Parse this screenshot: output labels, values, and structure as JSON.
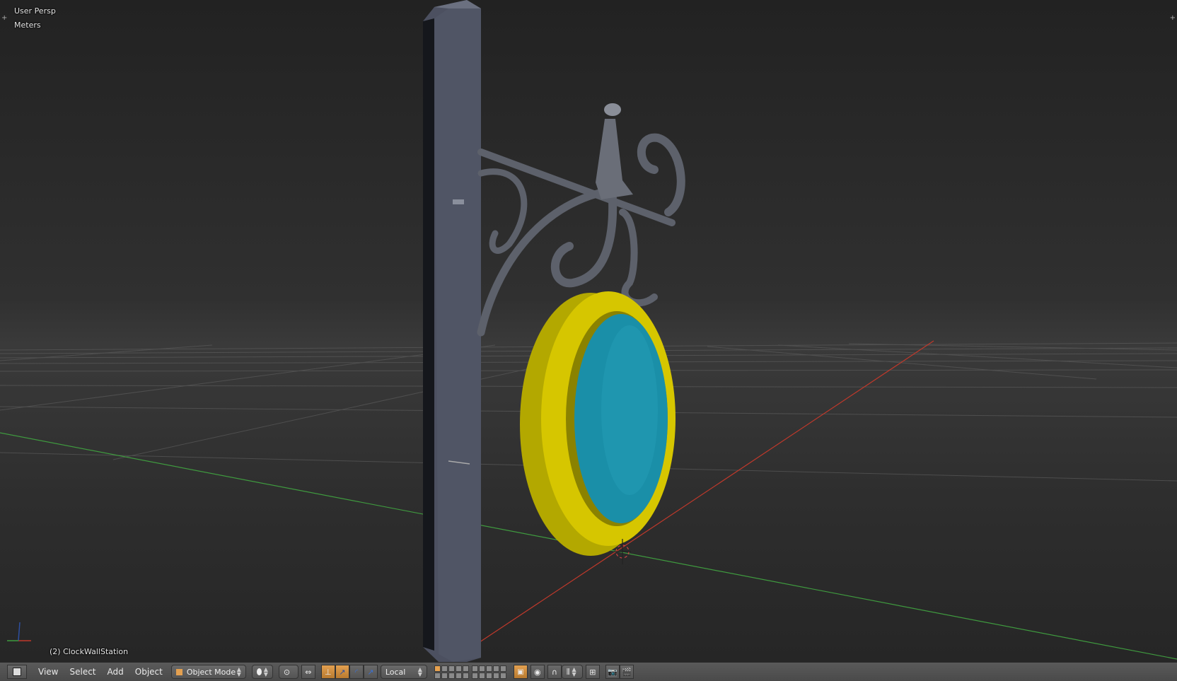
{
  "viewport": {
    "view_name": "User Persp",
    "units": "Meters",
    "active_object": "(2) ClockWallStation"
  },
  "header": {
    "editor_type_icon": "cube-editor-icon",
    "menus": [
      "View",
      "Select",
      "Add",
      "Object"
    ],
    "mode": "Object Mode",
    "shading_icon": "solid-sphere-icon",
    "pivot_icon": "pivot-point-icon",
    "transform_orientation": "Local",
    "layers_active": [
      0
    ]
  },
  "colors": {
    "x_axis": "#c0392b",
    "y_axis": "#3f9a3f",
    "clock_rim": "#d6c600",
    "clock_face": "#1a8fa8",
    "post": "#4a4e5c",
    "accent": "#e3a050"
  }
}
